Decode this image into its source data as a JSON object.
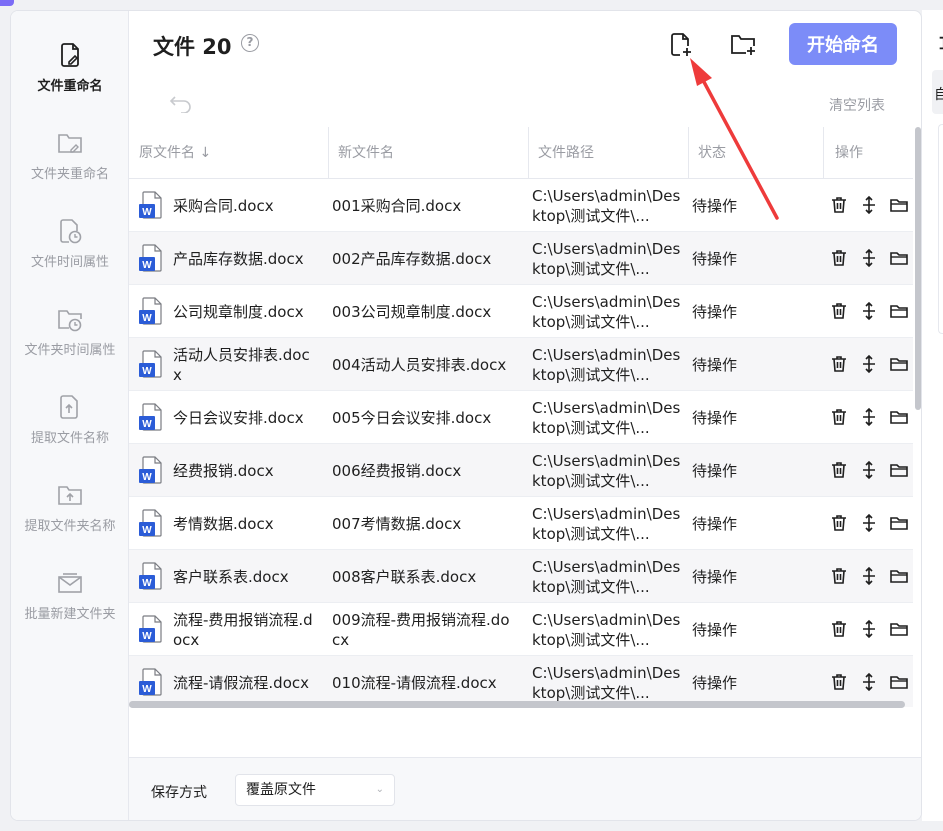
{
  "sidebar": {
    "items": [
      {
        "label": "文件重命名",
        "icon": "file-edit-icon",
        "active": true
      },
      {
        "label": "文件夹重命名",
        "icon": "folder-edit-icon"
      },
      {
        "label": "文件时间属性",
        "icon": "file-clock-icon"
      },
      {
        "label": "文件夹时间属性",
        "icon": "folder-clock-icon"
      },
      {
        "label": "提取文件名称",
        "icon": "file-upload-icon"
      },
      {
        "label": "提取文件夹名称",
        "icon": "folder-upload-icon"
      },
      {
        "label": "批量新建文件夹",
        "icon": "folder-batch-icon"
      }
    ]
  },
  "header": {
    "title": "文件 20",
    "help": "?",
    "start_button": "开始命名",
    "clear_list": "清空列表"
  },
  "table": {
    "columns": [
      "原文件名 ↓",
      "新文件名",
      "文件路径",
      "状态",
      "操作"
    ],
    "rows": [
      {
        "orig": "采购合同.docx",
        "new": "001采购合同.docx",
        "path": "C:\\Users\\admin\\Desktop\\测试文件\\...",
        "status": "待操作"
      },
      {
        "orig": "产品库存数据.docx",
        "new": "002产品库存数据.docx",
        "path": "C:\\Users\\admin\\Desktop\\测试文件\\...",
        "status": "待操作"
      },
      {
        "orig": "公司规章制度.docx",
        "new": "003公司规章制度.docx",
        "path": "C:\\Users\\admin\\Desktop\\测试文件\\...",
        "status": "待操作"
      },
      {
        "orig": "活动人员安排表.docx",
        "new": "004活动人员安排表.docx",
        "path": "C:\\Users\\admin\\Desktop\\测试文件\\...",
        "status": "待操作"
      },
      {
        "orig": "今日会议安排.docx",
        "new": "005今日会议安排.docx",
        "path": "C:\\Users\\admin\\Desktop\\测试文件\\...",
        "status": "待操作"
      },
      {
        "orig": "经费报销.docx",
        "new": "006经费报销.docx",
        "path": "C:\\Users\\admin\\Desktop\\测试文件\\...",
        "status": "待操作"
      },
      {
        "orig": "考情数据.docx",
        "new": "007考情数据.docx",
        "path": "C:\\Users\\admin\\Desktop\\测试文件\\...",
        "status": "待操作"
      },
      {
        "orig": "客户联系表.docx",
        "new": "008客户联系表.docx",
        "path": "C:\\Users\\admin\\Desktop\\测试文件\\...",
        "status": "待操作"
      },
      {
        "orig": "流程-费用报销流程.docx",
        "new": "009流程-费用报销流程.docx",
        "path": "C:\\Users\\admin\\Desktop\\测试文件\\...",
        "status": "待操作"
      },
      {
        "orig": "流程-请假流程.docx",
        "new": "010流程-请假流程.docx",
        "path": "C:\\Users\\admin\\Desktop\\测试文件\\...",
        "status": "待操作"
      }
    ]
  },
  "footer": {
    "save_label": "保存方式",
    "save_value": "覆盖原文件"
  },
  "right_panel": {
    "top_char": "Ｉ",
    "text": "自"
  },
  "colors": {
    "accent": "#7c8cf8",
    "arrow": "#ee3b3b",
    "word_icon": "#2b5cd7"
  }
}
